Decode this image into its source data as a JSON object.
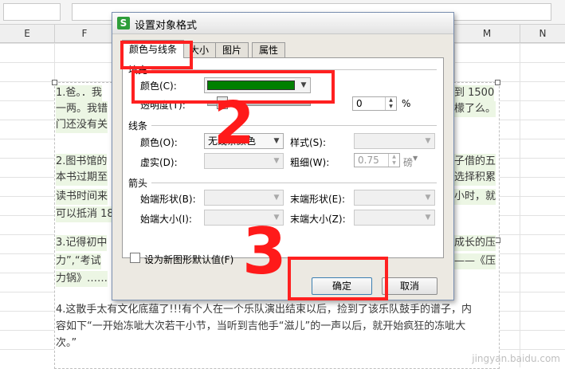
{
  "spreadsheet": {
    "columns": [
      "E",
      "F",
      "M",
      "N"
    ],
    "paragraphs": [
      {
        "left": "1.爸。．我",
        "right": "到 1500"
      },
      {
        "left": "一两。我错",
        "right": "檬了么。"
      },
      {
        "left": "门还没有关",
        "right": ""
      },
      {
        "left": "2.图书馆的",
        "right": "子借的五"
      },
      {
        "left": "本书过期至",
        "right": "选择积累"
      },
      {
        "left": "读书时间来",
        "right": "小时，就"
      },
      {
        "left": "可以抵消 18",
        "right": ""
      },
      {
        "left": "3.记得初中",
        "right": "成长的压"
      },
      {
        "left": "力”,“考试",
        "right": "——《压"
      },
      {
        "left": "力锅》……",
        "right": ""
      }
    ],
    "para4_line1": "4.这散手太有文化底蕴了!!!有个人在一个乐队演出结束以后，捡到了该乐队鼓手的谱子，内",
    "para4_line2": "容如下“一开始冻呲大次若干小节，当听到吉他手“滋儿”的一声以后，就开始疯狂的冻呲大",
    "para4_line3": "次。”",
    "watermark": "jingyan.baidu.com"
  },
  "dialog": {
    "title": "设置对象格式",
    "icon_letter": "S",
    "tabs": [
      "颜色与线条",
      "大小",
      "图片",
      "属性"
    ],
    "fill_group": "填充",
    "fill_color_label": "颜色(C):",
    "fill_color_hex": "#008000",
    "transparency_label": "透明度(T):",
    "transparency_value": "0",
    "percent": "%",
    "line_group": "线条",
    "line_color_label": "颜色(O):",
    "line_color_value": "无线条颜色",
    "line_style_label": "样式(S):",
    "dash_label": "虚实(D):",
    "weight_label": "粗细(W):",
    "weight_value": "0.75",
    "weight_unit": "磅",
    "arrow_group": "箭头",
    "begin_style_label": "始端形状(B):",
    "end_style_label": "末端形状(E):",
    "begin_size_label": "始端大小(I):",
    "end_size_label": "末端大小(Z):",
    "default_checkbox_label": "设为新图形默认值(F)",
    "ok_label": "确定",
    "cancel_label": "取消"
  },
  "annotations": {
    "mark_2": "2",
    "mark_3": "3"
  }
}
